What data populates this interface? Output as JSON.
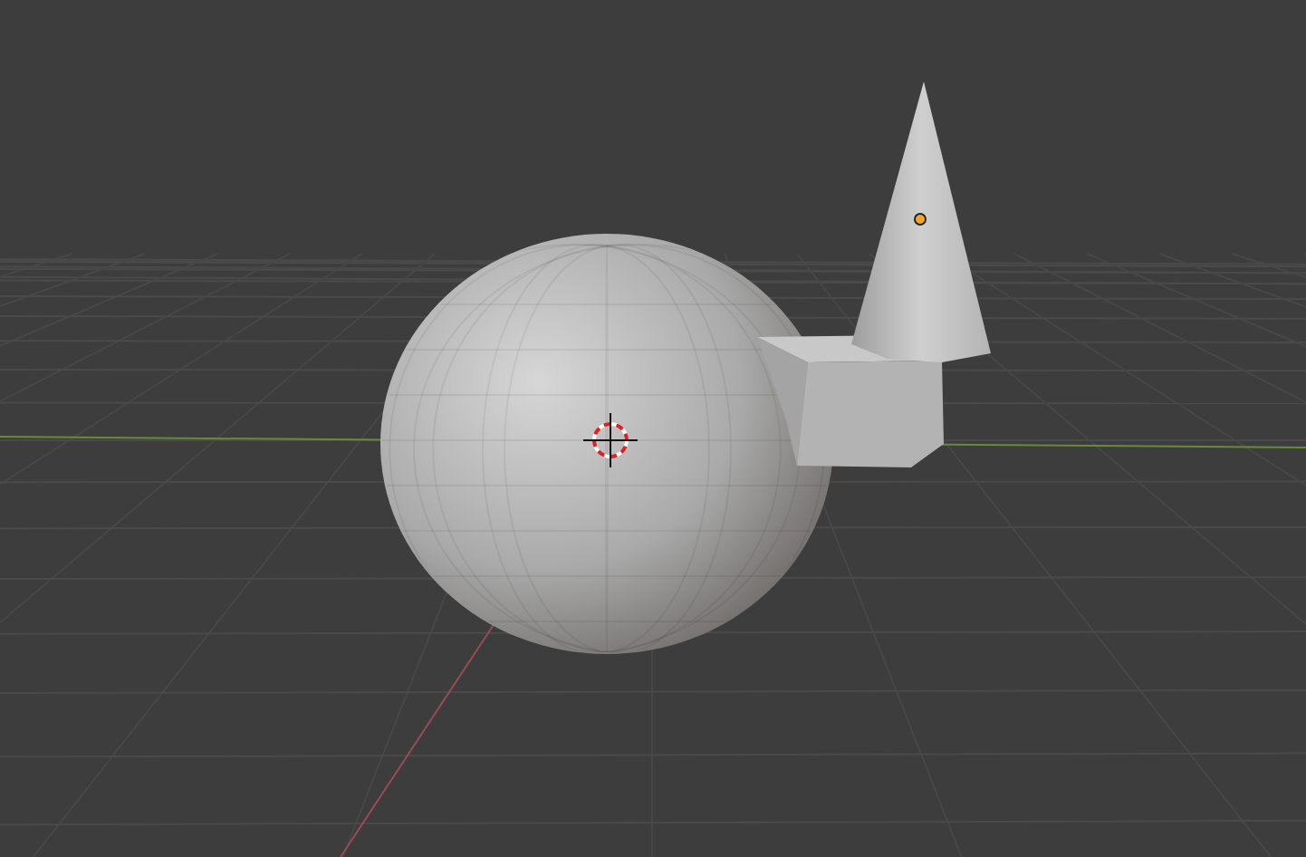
{
  "viewport": {
    "objects": [
      {
        "kind": "sphere"
      },
      {
        "kind": "cube"
      },
      {
        "kind": "cone",
        "origin_shown": true
      }
    ]
  }
}
